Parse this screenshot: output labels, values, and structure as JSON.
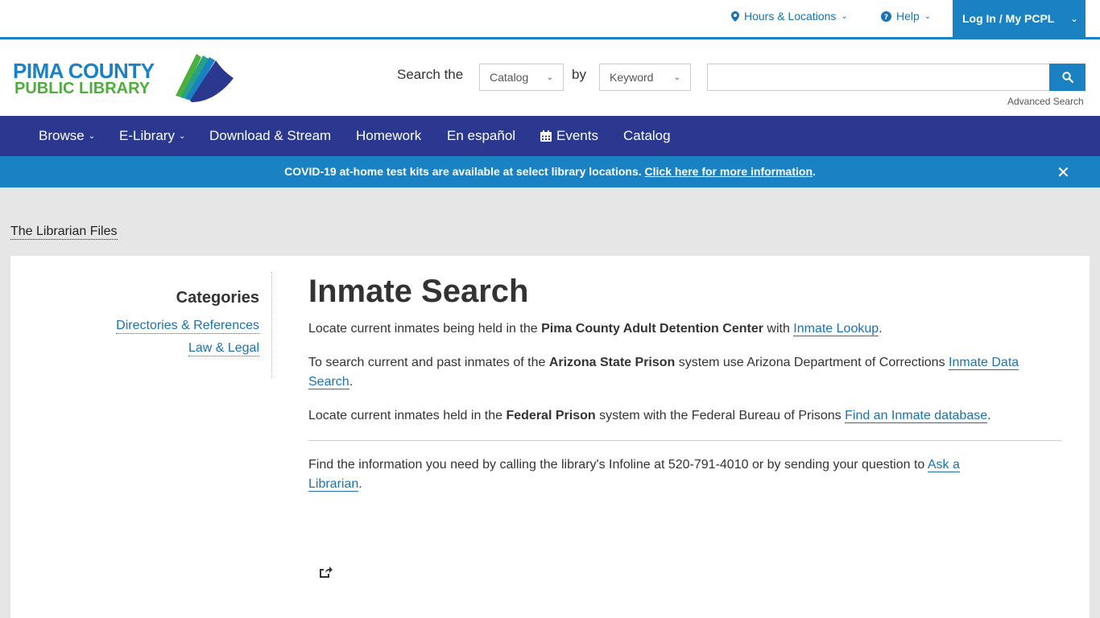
{
  "utility": {
    "hours": "Hours & Locations",
    "help": "Help",
    "login": "Log In / My PCPL"
  },
  "logo": {
    "line1": "PIMA COUNTY",
    "line2": "PUBLIC LIBRARY"
  },
  "search": {
    "label_prefix": "Search the",
    "scope_value": "Catalog",
    "by": "by",
    "type_value": "Keyword",
    "query_value": "",
    "advanced": "Advanced Search"
  },
  "nav": {
    "browse": "Browse",
    "elibrary": "E-Library",
    "download": "Download & Stream",
    "homework": "Homework",
    "espanol": "En español",
    "events": "Events",
    "catalog": "Catalog"
  },
  "alert": {
    "text": "COVID-19 at-home test kits are available at select library locations. ",
    "link": "Click here for more information",
    "end": ".",
    "close": "✕"
  },
  "breadcrumb": "The Librarian Files",
  "sidebar": {
    "title": "Categories",
    "items": [
      "Directories & References",
      "Law & Legal"
    ]
  },
  "main": {
    "title": "Inmate Search",
    "p1": {
      "a": "Locate current inmates being held in the ",
      "b": "Pima County Adult Detention Center",
      "c": " with ",
      "link": "Inmate Lookup",
      "d": "."
    },
    "p2": {
      "a": "To search current and past inmates of the ",
      "b": "Arizona State Prison",
      "c": " system use Arizona Department of Corrections ",
      "link1": "Inmate Data",
      "link2": "Search",
      "d": "."
    },
    "p3": {
      "a": "Locate current inmates held in the ",
      "b": "Federal Prison",
      "c": " system with the Federal Bureau of Prisons ",
      "link": "Find an Inmate database",
      "d": "."
    },
    "p4": {
      "a": "Find the information you need by calling the library's Infoline at 520-791-4010 or by sending your question to ",
      "link1": "Ask a",
      "link2": "Librarian",
      "d": "."
    }
  },
  "colors": {
    "brand_blue": "#1a82c3",
    "nav_indigo": "#2b388f",
    "logo_green": "#4caf3c"
  }
}
